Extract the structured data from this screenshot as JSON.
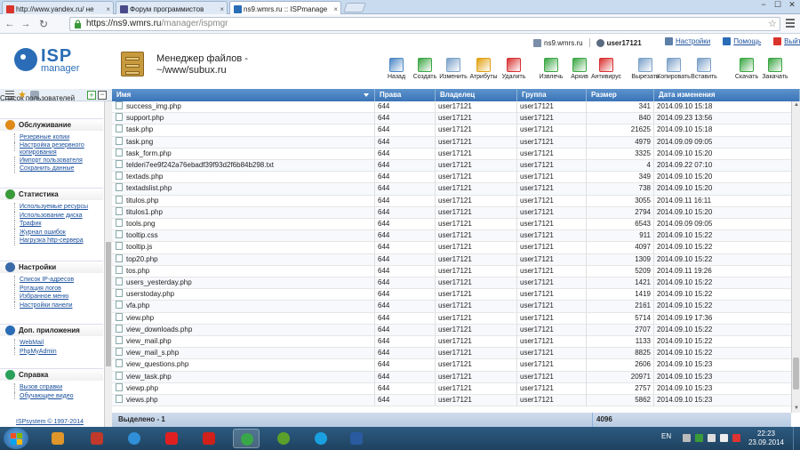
{
  "browser": {
    "tabs": [
      {
        "label": "http://www.yandex.ru/ не",
        "fav_color": "#d9342b",
        "active": false
      },
      {
        "label": "Форум программистов",
        "fav_color": "#4a4a8a",
        "active": false
      },
      {
        "label": "ns9.wmrs.ru :: ISPmanage",
        "fav_color": "#2a6db6",
        "active": true
      }
    ],
    "url_host": "https://ns9.wmrs.ru",
    "url_path": "/manager/ispmgr",
    "window_controls": [
      "−",
      "☐",
      "✕"
    ]
  },
  "header": {
    "logo_line1": "ISP",
    "logo_line2": "manager",
    "page_title": "Менеджер файлов - ~/www/subux.ru",
    "server": "ns9.wmrs.ru",
    "user": "user17121",
    "links": [
      {
        "label": "Настройки",
        "icon": "settings-icon",
        "color": "#5a7fa8"
      },
      {
        "label": "Помощь",
        "icon": "help-icon",
        "color": "#2a6db6"
      },
      {
        "label": "Выйти",
        "icon": "exit-icon",
        "color": "#d9342b"
      }
    ]
  },
  "toolbar": [
    {
      "label": "Назад",
      "icon": "back-arrow-icon",
      "color": "#4a86c5"
    },
    {
      "label": "Создать",
      "icon": "create-icon",
      "color": "#3aa642"
    },
    {
      "label": "Изменить",
      "icon": "edit-icon",
      "color": "#7aa0c8"
    },
    {
      "label": "Атрибуты",
      "icon": "attributes-icon",
      "color": "#e0a010"
    },
    {
      "label": "Удалить",
      "icon": "delete-icon",
      "color": "#d93030"
    },
    {
      "label": "Извлечь",
      "icon": "extract-icon",
      "color": "#3aa642"
    },
    {
      "label": "Архив",
      "icon": "archive-icon",
      "color": "#3aa642"
    },
    {
      "label": "Антивирус",
      "icon": "antivirus-icon",
      "color": "#d93030"
    },
    {
      "label": "Вырезать",
      "icon": "cut-icon",
      "color": "#7aa0c8"
    },
    {
      "label": "Копировать",
      "icon": "copy-icon",
      "color": "#7aa0c8"
    },
    {
      "label": "Вставить",
      "icon": "paste-icon",
      "color": "#7aa0c8"
    },
    {
      "label": "Скачать",
      "icon": "download-icon",
      "color": "#3aa642"
    },
    {
      "label": "Закачать",
      "icon": "upload-icon",
      "color": "#3aa642"
    }
  ],
  "sidebar": {
    "partial_item": "Список пользователей",
    "sections": [
      {
        "title": "Обслуживание",
        "icon": "maintenance-icon",
        "color": "#e08a1a",
        "items": [
          "Резервные копии",
          "Настройка резервного копирования",
          "Импорт пользователя",
          "Сохранить данные"
        ]
      },
      {
        "title": "Статистика",
        "icon": "statistics-icon",
        "color": "#3a9a3a",
        "items": [
          "Используемые ресурсы",
          "Использование диска",
          "Трафик",
          "Журнал ошибок",
          "Нагрузка http-сервера"
        ]
      },
      {
        "title": "Настройки",
        "icon": "settings-section-icon",
        "color": "#3a6aa8",
        "items": [
          "Список IP-адресов",
          "Ротация логов",
          "Избранное меню",
          "Настройки панели"
        ]
      },
      {
        "title": "Доп. приложения",
        "icon": "apps-icon",
        "color": "#2a6db6",
        "items": [
          "WebMail",
          "PhpMyAdmin"
        ]
      },
      {
        "title": "Справка",
        "icon": "help-section-icon",
        "color": "#2aa05a",
        "items": [
          "Вызов справки",
          "Обучающее видео"
        ]
      }
    ],
    "copyright": "ISPsystem © 1997-2014"
  },
  "table": {
    "columns": [
      "Имя",
      "Права",
      "Владелец",
      "Группа",
      "Размер",
      "Дата изменения"
    ],
    "rows": [
      [
        "success_img.php",
        "644",
        "user17121",
        "user17121",
        "341",
        "2014.09.10 15:18"
      ],
      [
        "support.php",
        "644",
        "user17121",
        "user17121",
        "840",
        "2014.09.23 13:56"
      ],
      [
        "task.php",
        "644",
        "user17121",
        "user17121",
        "21625",
        "2014.09.10 15:18"
      ],
      [
        "task.png",
        "644",
        "user17121",
        "user17121",
        "4979",
        "2014.09.09 09:05"
      ],
      [
        "task_form.php",
        "644",
        "user17121",
        "user17121",
        "3325",
        "2014.09.10 15:20"
      ],
      [
        "telderi7ee9f242a76ebadf39f93d2f6b84b298.txt",
        "644",
        "user17121",
        "user17121",
        "4",
        "2014.09.22 07:10"
      ],
      [
        "textads.php",
        "644",
        "user17121",
        "user17121",
        "349",
        "2014.09.10 15:20"
      ],
      [
        "textadslist.php",
        "644",
        "user17121",
        "user17121",
        "738",
        "2014.09.10 15:20"
      ],
      [
        "titulos.php",
        "644",
        "user17121",
        "user17121",
        "3055",
        "2014.09.11 16:11"
      ],
      [
        "titulos1.php",
        "644",
        "user17121",
        "user17121",
        "2794",
        "2014.09.10 15:20"
      ],
      [
        "tools.png",
        "644",
        "user17121",
        "user17121",
        "6543",
        "2014.09.09 09:05"
      ],
      [
        "tooltip.css",
        "644",
        "user17121",
        "user17121",
        "911",
        "2014.09.10 15:22"
      ],
      [
        "tooltip.js",
        "644",
        "user17121",
        "user17121",
        "4097",
        "2014.09.10 15:22"
      ],
      [
        "top20.php",
        "644",
        "user17121",
        "user17121",
        "1309",
        "2014.09.10 15:22"
      ],
      [
        "tos.php",
        "644",
        "user17121",
        "user17121",
        "5209",
        "2014.09.11 19:26"
      ],
      [
        "users_yesterday.php",
        "644",
        "user17121",
        "user17121",
        "1421",
        "2014.09.10 15:22"
      ],
      [
        "userstoday.php",
        "644",
        "user17121",
        "user17121",
        "1419",
        "2014.09.10 15:22"
      ],
      [
        "vfa.php",
        "644",
        "user17121",
        "user17121",
        "2161",
        "2014.09.10 15:22"
      ],
      [
        "view.php",
        "644",
        "user17121",
        "user17121",
        "5714",
        "2014.09.19 17:36"
      ],
      [
        "view_downloads.php",
        "644",
        "user17121",
        "user17121",
        "2707",
        "2014.09.10 15:22"
      ],
      [
        "view_mail.php",
        "644",
        "user17121",
        "user17121",
        "1133",
        "2014.09.10 15:22"
      ],
      [
        "view_mail_s.php",
        "644",
        "user17121",
        "user17121",
        "8825",
        "2014.09.10 15:22"
      ],
      [
        "view_questions.php",
        "644",
        "user17121",
        "user17121",
        "2606",
        "2014.09.10 15:23"
      ],
      [
        "view_task.php",
        "644",
        "user17121",
        "user17121",
        "20971",
        "2014.09.10 15:23"
      ],
      [
        "viewp.php",
        "644",
        "user17121",
        "user17121",
        "2757",
        "2014.09.10 15:23"
      ],
      [
        "views.php",
        "644",
        "user17121",
        "user17121",
        "5862",
        "2014.09.10 15:23"
      ]
    ],
    "footer_selected": "Выделено - 1",
    "footer_size": "4096"
  },
  "taskbar": {
    "apps": [
      {
        "icon": "media-player-icon",
        "color": "#e0962a"
      },
      {
        "icon": "game-icon",
        "color": "#c0392b"
      },
      {
        "icon": "internet-explorer-icon",
        "color": "#2f8fd8"
      },
      {
        "icon": "yandex-browser-icon",
        "color": "#e02020"
      },
      {
        "icon": "opera-icon",
        "color": "#d0201a"
      },
      {
        "icon": "chrome-icon",
        "color": "#3aa64a"
      },
      {
        "icon": "torrent-icon",
        "color": "#5aa02a"
      },
      {
        "icon": "skype-icon",
        "color": "#1aa0e0"
      },
      {
        "icon": "app-icon",
        "color": "#2a5aa0"
      }
    ],
    "lang": "EN",
    "time": "22:23",
    "date": "23.09.2014"
  }
}
